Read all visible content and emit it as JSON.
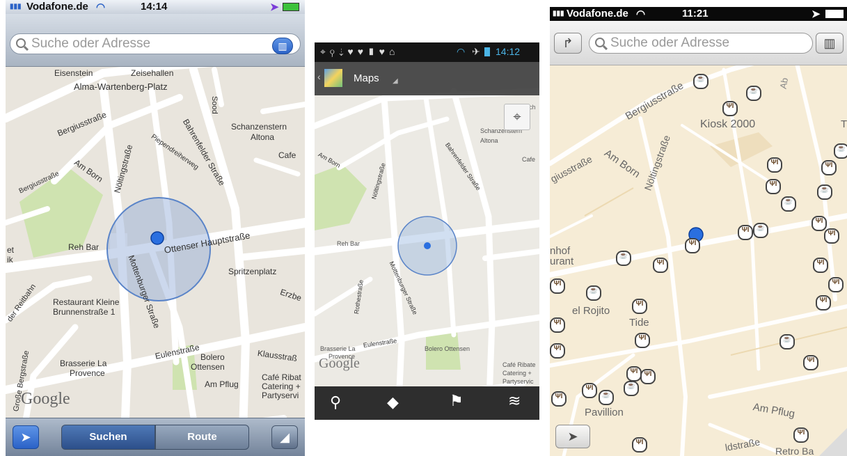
{
  "phone1": {
    "status": {
      "carrier": "Vodafone.de",
      "time": "14:14"
    },
    "search": {
      "placeholder": "Suche oder Adresse"
    },
    "map_labels": {
      "l1": "Eisenstein",
      "l2": "Zeisehallen",
      "l3": "Alma-Wartenberg-Platz",
      "l4": "Bergiusstraße",
      "l5": "Am Born",
      "l6": "Nöltingstraße",
      "l7": "Piependreiherweg",
      "l8": "Bahrenfelder Straße",
      "l9": "Schanzenstern",
      "l10": "Altona",
      "l11": "Cafe",
      "l12": "Bergiusstraße",
      "l13": "Reh Bar",
      "l14": "Ottenser Hauptstraße",
      "l15": "Mottenburger Straße",
      "l16": "Spritzenplatz",
      "l17": "Erzbe",
      "l18": "Restaurant Kleine",
      "l19": "Brunnenstraße 1",
      "l20": "Eulenstraße",
      "l21": "Klausstraß",
      "l22": "Brasserie La",
      "l23": "Provence",
      "l24": "Bolero",
      "l25": "Ottensen",
      "l26": "Am Pflug",
      "l27": "Café Ribat",
      "l28": "Catering +",
      "l29": "Partyservi",
      "l30": "der Reitbahn",
      "l31": "Große Bergstraße",
      "l32": "Sood",
      "l33": "Google",
      "l34": "et",
      "l35": "ik"
    },
    "tabs": {
      "search": "Suchen",
      "route": "Route"
    }
  },
  "phone2": {
    "status": {
      "time": "14:12"
    },
    "app_title": "Maps",
    "map_labels": {
      "l1": "Hohenesch",
      "l2": "Schanzenstern",
      "l3": "Altona",
      "l4": "Cafe",
      "l5": "Am Born",
      "l6": "Nöltingstraße",
      "l7": "Bahrenfelder Straße",
      "l8": "Reh Bar",
      "l9": "Mottenburger Straße",
      "l10": "Rothestraße",
      "l11": "Brasserie La",
      "l12": "Provence",
      "l13": "Eulenstraße",
      "l14": "Bolero Ottensen",
      "l15": "Café Ribate",
      "l16": "Catering +",
      "l17": "Partyservic",
      "l18": "Google"
    }
  },
  "phone3": {
    "status": {
      "carrier": "Vodafone.de",
      "time": "11:21"
    },
    "search": {
      "placeholder": "Suche oder Adresse"
    },
    "map_labels": {
      "l1": "Bergiusstraße",
      "l2": "Kiosk 2000",
      "l3": "Am Born",
      "l4": "Nöltingstraße",
      "l5": "giusstraße",
      "l6": "nhof",
      "l7": "urant",
      "l8": "el Rojito",
      "l9": "Tide",
      "l10": "Pavillion",
      "l11": "Am Pflug",
      "l12": "ldstraße",
      "l13": "Retro Ba",
      "l14": "Ab",
      "l15": "T"
    }
  },
  "colors": {
    "ios_blue": "#2b62c7",
    "accuracy_circle": "#5a84c8",
    "poi_brown": "#b98a54",
    "park_green": "#cfe3b0"
  }
}
